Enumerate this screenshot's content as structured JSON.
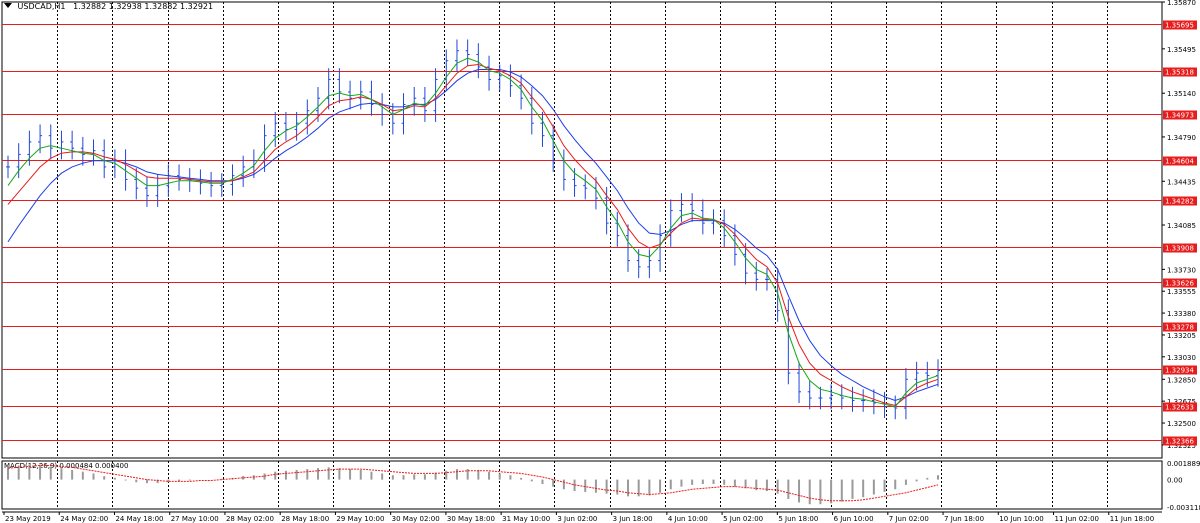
{
  "symbol": "USDCAD,H1",
  "ohlc": "1.32882 1.32938 1.32882 1.32921",
  "macd": {
    "label": "MACD(12,26,9)",
    "values": "0.000484 0.000400",
    "scale": [
      "0.001889",
      "0.00",
      "-0.003118"
    ]
  },
  "colors": {
    "candle": "#1f47d8",
    "ma_fast": "#16a816",
    "ma_mid": "#e81c1c",
    "ma_slow": "#1c3ee8",
    "level": "#e81c1c",
    "grid": "#000000",
    "signal": "#e81c1c"
  },
  "chart_data": {
    "type": "line",
    "price_levels": [
      "1.35695",
      "1.35318",
      "1.34973",
      "1.34604",
      "1.34282",
      "1.33908",
      "1.33626",
      "1.33278",
      "1.32934",
      "1.32633",
      "1.32366"
    ],
    "y_ticks": [
      "1.35870",
      "1.35495",
      "1.35140",
      "1.34790",
      "1.34435",
      "1.34085",
      "1.33730",
      "1.33555",
      "1.33380",
      "1.33205",
      "1.33030",
      "1.32850",
      "1.32675",
      "1.32500",
      "1.32325"
    ],
    "x_labels": [
      "23 May 2019",
      "24 May 02:00",
      "24 May 18:00",
      "27 May 10:00",
      "28 May 02:00",
      "28 May 18:00",
      "29 May 10:00",
      "30 May 02:00",
      "30 May 18:00",
      "31 May 10:00",
      "3 Jun 02:00",
      "3 Jun 18:00",
      "4 Jun 10:00",
      "5 Jun 02:00",
      "5 Jun 18:00",
      "6 Jun 10:00",
      "7 Jun 02:00",
      "7 Jun 18:00",
      "10 Jun 10:00",
      "11 Jun 02:00",
      "11 Jun 18:00"
    ],
    "ylim": [
      1.3222,
      1.3587
    ],
    "close": [
      1.3455,
      1.3465,
      1.3475,
      1.348,
      1.347,
      1.3475,
      1.347,
      1.3465,
      1.3468,
      1.3455,
      1.346,
      1.3445,
      1.3438,
      1.3432,
      1.344,
      1.3448,
      1.3445,
      1.3444,
      1.3442,
      1.344,
      1.3441,
      1.3448,
      1.3455,
      1.346,
      1.348,
      1.349,
      1.3485,
      1.349,
      1.35,
      1.351,
      1.3525,
      1.3515,
      1.351,
      1.3515,
      1.3505,
      1.3497,
      1.349,
      1.3505,
      1.351,
      1.35,
      1.3525,
      1.354,
      1.3548,
      1.3545,
      1.3535,
      1.3525,
      1.3528,
      1.352,
      1.351,
      1.349,
      1.348,
      1.346,
      1.3445,
      1.344,
      1.3438,
      1.343,
      1.341,
      1.34,
      1.338,
      1.3375,
      1.338,
      1.34,
      1.342,
      1.3425,
      1.342,
      1.341,
      1.3412,
      1.34,
      1.3385,
      1.337,
      1.3365,
      1.3365,
      1.334,
      1.329,
      1.3275,
      1.327,
      1.327,
      1.3272,
      1.327,
      1.3268,
      1.3268,
      1.3266,
      1.3263,
      1.3262,
      1.3285,
      1.329,
      1.3288,
      1.3292
    ],
    "ma_fast": [
      1.344,
      1.3452,
      1.3462,
      1.347,
      1.3472,
      1.347,
      1.3468,
      1.3466,
      1.3465,
      1.346,
      1.3458,
      1.3452,
      1.3446,
      1.344,
      1.344,
      1.3442,
      1.3444,
      1.3444,
      1.3443,
      1.3442,
      1.3442,
      1.3445,
      1.345,
      1.3456,
      1.3468,
      1.3478,
      1.3484,
      1.3488,
      1.3495,
      1.3503,
      1.3512,
      1.3514,
      1.3512,
      1.3513,
      1.3509,
      1.3503,
      1.3497,
      1.3501,
      1.3506,
      1.3504,
      1.3514,
      1.3527,
      1.3538,
      1.3542,
      1.3539,
      1.3532,
      1.353,
      1.3525,
      1.3517,
      1.3503,
      1.3492,
      1.3476,
      1.346,
      1.345,
      1.3444,
      1.3437,
      1.3423,
      1.3411,
      1.3395,
      1.3385,
      1.3383,
      1.3392,
      1.3406,
      1.3416,
      1.3418,
      1.3414,
      1.3413,
      1.3406,
      1.3395,
      1.3382,
      1.3373,
      1.3369,
      1.3354,
      1.3322,
      1.3298,
      1.3284,
      1.3277,
      1.3275,
      1.3272,
      1.327,
      1.3269,
      1.3267,
      1.3265,
      1.3263,
      1.3274,
      1.3282,
      1.3285,
      1.3288
    ],
    "ma_mid": [
      1.3425,
      1.3435,
      1.3445,
      1.3455,
      1.3462,
      1.3466,
      1.3467,
      1.3467,
      1.3466,
      1.3463,
      1.3461,
      1.3457,
      1.3452,
      1.3447,
      1.3446,
      1.3446,
      1.3446,
      1.3445,
      1.3444,
      1.3443,
      1.3443,
      1.3444,
      1.3447,
      1.3451,
      1.346,
      1.3469,
      1.3475,
      1.348,
      1.3487,
      1.3495,
      1.3504,
      1.3508,
      1.3509,
      1.3511,
      1.3509,
      1.3505,
      1.35,
      1.3501,
      1.3504,
      1.3503,
      1.351,
      1.352,
      1.353,
      1.3536,
      1.3537,
      1.3534,
      1.3532,
      1.3528,
      1.3522,
      1.3511,
      1.3501,
      1.3487,
      1.3472,
      1.3461,
      1.3452,
      1.3444,
      1.3432,
      1.3421,
      1.3406,
      1.3395,
      1.339,
      1.3393,
      1.3402,
      1.341,
      1.3414,
      1.3413,
      1.3413,
      1.3409,
      1.3401,
      1.339,
      1.3381,
      1.3375,
      1.3362,
      1.3335,
      1.3313,
      1.3298,
      1.3289,
      1.3284,
      1.3279,
      1.3275,
      1.3272,
      1.3269,
      1.3266,
      1.3264,
      1.3271,
      1.3278,
      1.3282,
      1.3285
    ],
    "ma_slow": [
      1.3395,
      1.3408,
      1.342,
      1.3432,
      1.3442,
      1.345,
      1.3455,
      1.3458,
      1.346,
      1.346,
      1.346,
      1.3458,
      1.3455,
      1.3451,
      1.3449,
      1.3448,
      1.3447,
      1.3446,
      1.3445,
      1.3444,
      1.3444,
      1.3444,
      1.3446,
      1.3449,
      1.3455,
      1.3462,
      1.3468,
      1.3473,
      1.3479,
      1.3486,
      1.3494,
      1.3499,
      1.3502,
      1.3505,
      1.3506,
      1.3505,
      1.3503,
      1.3503,
      1.3505,
      1.3505,
      1.3509,
      1.3516,
      1.3524,
      1.353,
      1.3533,
      1.3533,
      1.3533,
      1.3531,
      1.3527,
      1.352,
      1.3512,
      1.3501,
      1.3488,
      1.3477,
      1.3467,
      1.3458,
      1.3447,
      1.3436,
      1.3422,
      1.341,
      1.3402,
      1.3401,
      1.3404,
      1.3409,
      1.3412,
      1.3412,
      1.3412,
      1.341,
      1.3405,
      1.3398,
      1.339,
      1.3384,
      1.3373,
      1.3352,
      1.3332,
      1.3316,
      1.3304,
      1.3296,
      1.3289,
      1.3284,
      1.3279,
      1.3275,
      1.3271,
      1.3268,
      1.3271,
      1.3275,
      1.3278,
      1.3281
    ],
    "macd_hist": [
      0.0015,
      0.0016,
      0.0017,
      0.0017,
      0.0015,
      0.0013,
      0.0011,
      0.0009,
      0.0007,
      0.0004,
      0.0002,
      -0.0001,
      -0.0003,
      -0.0004,
      -0.0004,
      -0.0003,
      -0.0002,
      -0.0001,
      0.0,
      0.0,
      0.0001,
      0.0002,
      0.0004,
      0.0005,
      0.0007,
      0.0009,
      0.001,
      0.0011,
      0.0012,
      0.0013,
      0.0014,
      0.0013,
      0.0012,
      0.0011,
      0.0009,
      0.0007,
      0.0005,
      0.0005,
      0.0006,
      0.0006,
      0.0008,
      0.001,
      0.0012,
      0.0012,
      0.0011,
      0.0009,
      0.0007,
      0.0005,
      0.0002,
      -0.0002,
      -0.0005,
      -0.0008,
      -0.0011,
      -0.0013,
      -0.0014,
      -0.0015,
      -0.0016,
      -0.0017,
      -0.0019,
      -0.0019,
      -0.0018,
      -0.0015,
      -0.0011,
      -0.0008,
      -0.0006,
      -0.0005,
      -0.0005,
      -0.0006,
      -0.0008,
      -0.001,
      -0.0012,
      -0.0013,
      -0.0016,
      -0.0022,
      -0.0026,
      -0.0028,
      -0.0028,
      -0.0027,
      -0.0025,
      -0.0022,
      -0.002,
      -0.0017,
      -0.0014,
      -0.0011,
      -0.0006,
      -0.0002,
      0.0002,
      0.0005
    ],
    "macd_signal": [
      0.0013,
      0.0014,
      0.0015,
      0.0016,
      0.0016,
      0.0015,
      0.0014,
      0.0012,
      0.001,
      0.0008,
      0.0006,
      0.0004,
      0.0002,
      0.0,
      -0.0001,
      -0.0002,
      -0.0002,
      -0.0002,
      -0.0001,
      -0.0001,
      0.0,
      0.0001,
      0.0002,
      0.0003,
      0.0004,
      0.0006,
      0.0007,
      0.0008,
      0.0009,
      0.001,
      0.0011,
      0.0012,
      0.0012,
      0.0012,
      0.0011,
      0.001,
      0.0009,
      0.0008,
      0.0007,
      0.0007,
      0.0007,
      0.0008,
      0.0009,
      0.001,
      0.001,
      0.001,
      0.0009,
      0.0008,
      0.0007,
      0.0005,
      0.0003,
      0.0,
      -0.0003,
      -0.0006,
      -0.0008,
      -0.001,
      -0.0012,
      -0.0013,
      -0.0015,
      -0.0016,
      -0.0017,
      -0.0016,
      -0.0015,
      -0.0013,
      -0.0011,
      -0.001,
      -0.0009,
      -0.0008,
      -0.0008,
      -0.0009,
      -0.001,
      -0.0011,
      -0.0012,
      -0.0015,
      -0.0018,
      -0.0021,
      -0.0023,
      -0.0024,
      -0.0024,
      -0.0024,
      -0.0023,
      -0.0021,
      -0.0019,
      -0.0017,
      -0.0015,
      -0.0012,
      -0.0009,
      -0.0006
    ]
  }
}
